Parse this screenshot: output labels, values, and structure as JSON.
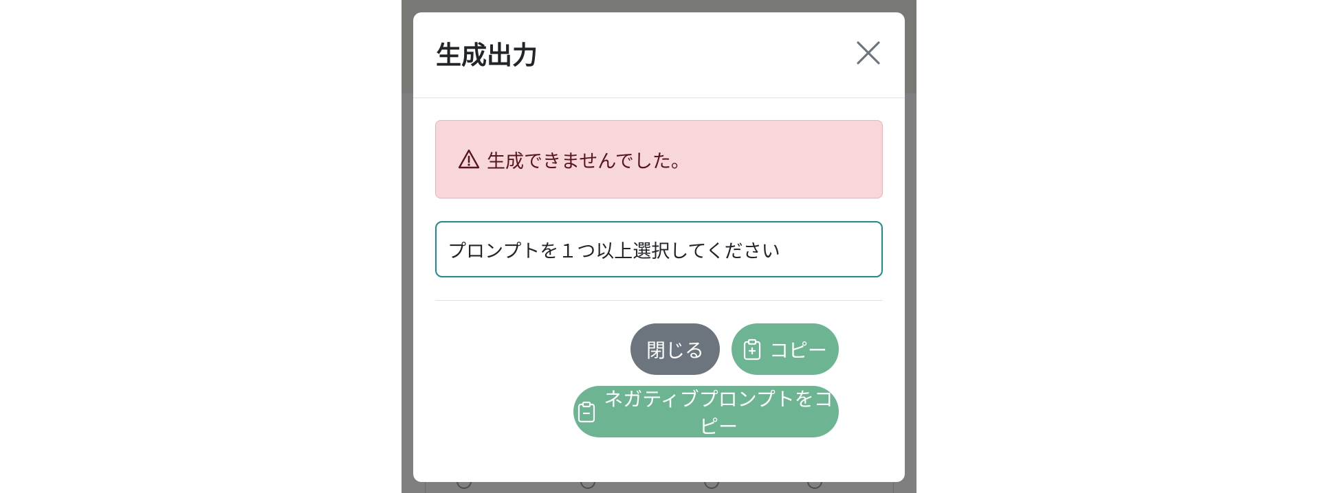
{
  "modal": {
    "title": "生成出力",
    "close_icon": "close-icon"
  },
  "alert": {
    "icon": "warning-triangle-icon",
    "message": "生成できませんでした。"
  },
  "output": {
    "text": "プロンプトを１つ以上選択してください"
  },
  "footer": {
    "close_label": "閉じる",
    "copy_icon": "clipboard-plus-icon",
    "copy_label": "コピー",
    "copy_negative_icon": "clipboard-minus-icon",
    "copy_negative_label": "ネガティブプロンプトをコピー"
  },
  "colors": {
    "alert_bg": "#f8d7da",
    "alert_text": "#58151c",
    "secondary_button": "#6c757d",
    "success_button": "#6db592",
    "output_border": "#1d8a8f"
  }
}
